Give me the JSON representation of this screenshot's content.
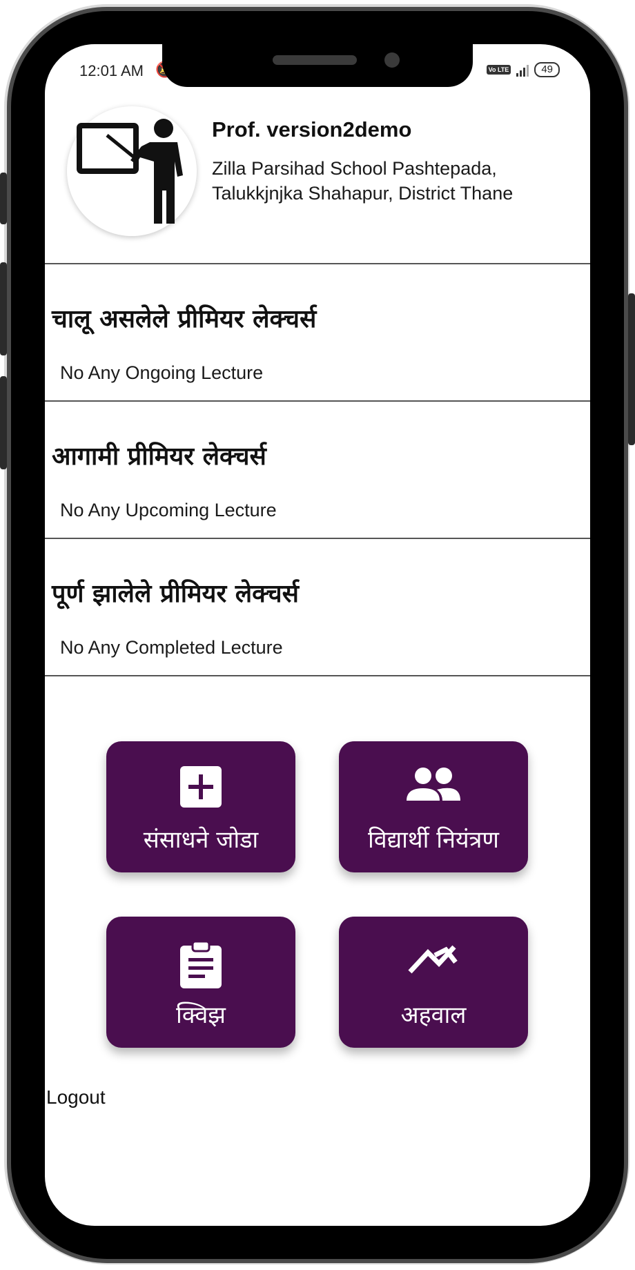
{
  "status_bar": {
    "time": "12:01 AM",
    "network_label": "Vo LTE",
    "battery": "49"
  },
  "profile": {
    "name": "Prof. version2demo",
    "school_line1": "Zilla Parsihad School Pashtepada,",
    "school_line2": "Talukkjnjka Shahapur, District Thane"
  },
  "sections": [
    {
      "heading": "चालू असलेले प्रीमियर लेक्चर्स",
      "text": "No Any Ongoing Lecture"
    },
    {
      "heading": "आगामी प्रीमियर लेक्चर्स",
      "text": "No Any Upcoming Lecture"
    },
    {
      "heading": "पूर्ण झालेले प्रीमियर लेक्चर्स",
      "text": "No Any Completed Lecture"
    }
  ],
  "tiles": [
    {
      "label": "संसाधने जोडा",
      "icon": "add-box-icon"
    },
    {
      "label": "विद्यार्थी नियंत्रण",
      "icon": "people-icon"
    },
    {
      "label": "क्विझ",
      "icon": "clipboard-icon"
    },
    {
      "label": "अहवाल",
      "icon": "trending-icon"
    }
  ],
  "colors": {
    "tile_background": "#4a0e4f"
  },
  "logout_label": "Logout"
}
